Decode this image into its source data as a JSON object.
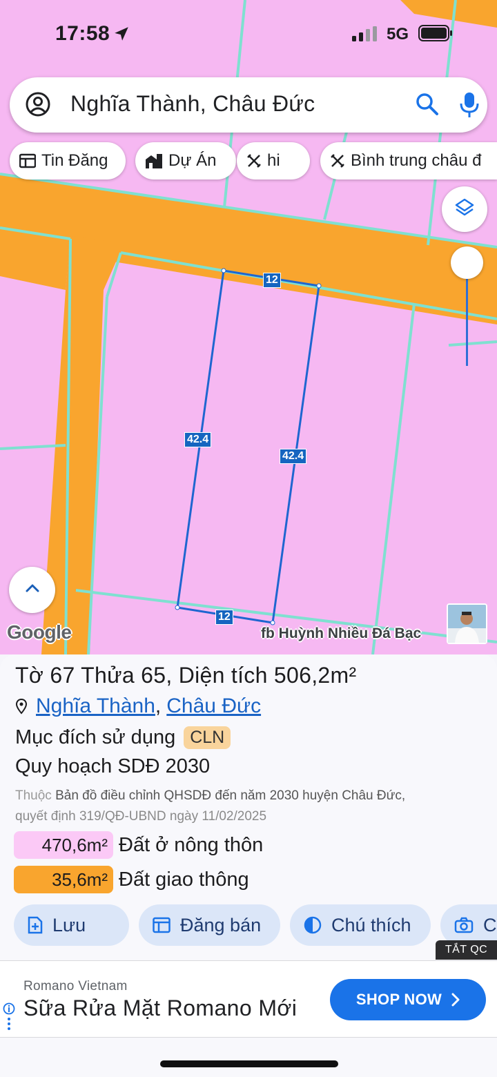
{
  "status_bar": {
    "time": "17:58",
    "network": "5G",
    "icons": [
      "location-arrow-icon",
      "signal-icon",
      "battery-icon"
    ]
  },
  "search": {
    "query": "Nghĩa Thành, Châu Đức",
    "icons": [
      "account-icon",
      "search-icon",
      "mic-icon"
    ]
  },
  "chips": [
    {
      "label": "Tin Đăng",
      "icon": "listing-icon"
    },
    {
      "label": "Dự Án",
      "icon": "building-icon"
    },
    {
      "label": "hi",
      "icon": "ruler-pencil-icon"
    },
    {
      "label": "Bình trung châu đ",
      "icon": "ruler-pencil-icon"
    }
  ],
  "map": {
    "edge_labels": [
      "12",
      "42.4",
      "42.4",
      "12"
    ],
    "google_logo": "Google",
    "watermark": "fb Huỳnh Nhiều Đá Bạc",
    "colors": {
      "land": "#f6b8f2",
      "road": "#f9a52e",
      "boundary": "#7fe0d0",
      "plot_outline": "#1e66d0"
    }
  },
  "sheet": {
    "title_prefix": "Tờ",
    "sheet_number": "67",
    "title_mid": "Thửa",
    "parcel_number": "65",
    "area_prefix": ", Diện tích",
    "area": "506,2m²",
    "location_ward": "Nghĩa Thành",
    "location_district": "Châu Đức",
    "purpose_label": "Mục đích sử dụng",
    "purpose_code": "CLN",
    "plan_title": "Quy hoạch SDĐ 2030",
    "plan_desc_prefix": "Thuộc",
    "plan_desc_main": "Bản đồ điều chỉnh QHSDĐ đến năm 2030 huyện Châu Đức,",
    "plan_desc_line2": "quyết định 319/QĐ-UBND ngày 11/02/2025",
    "land_uses": [
      {
        "area": "470,6m²",
        "label": "Đất ở nông thôn",
        "color": "#fbc9f6"
      },
      {
        "area": "35,6m²",
        "label": "Đất giao thông",
        "color": "#f9a52e"
      }
    ],
    "actions": [
      {
        "label": "Lưu",
        "icon": "save-add-icon"
      },
      {
        "label": "Đăng bán",
        "icon": "listing-icon"
      },
      {
        "label": "Chú thích",
        "icon": "contrast-icon"
      },
      {
        "label": "C",
        "icon": "camera-icon"
      }
    ],
    "ad_toggle": "TẮT QC"
  },
  "ad": {
    "advertiser": "Romano Vietnam",
    "headline": "Sữa Rửa Mặt Romano Mới",
    "cta": "SHOP NOW",
    "accent": "#1a73e8"
  }
}
